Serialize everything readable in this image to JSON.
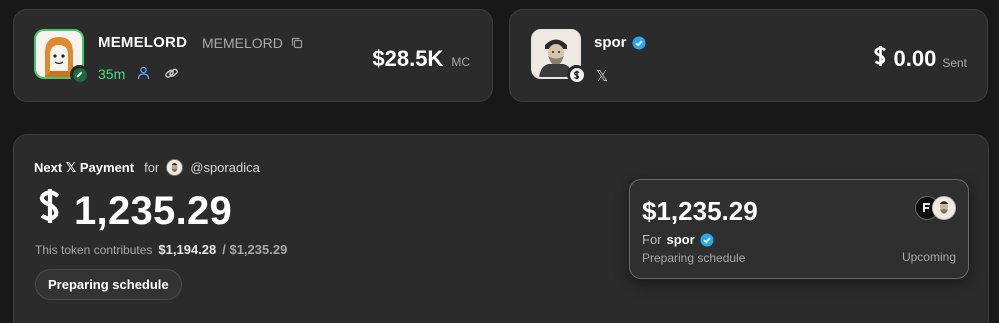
{
  "colors": {
    "accent_green": "#4ade80",
    "verified_blue": "#29a8f0",
    "card_bg": "#2b2b2b"
  },
  "token": {
    "name": "MEMELORD",
    "symbol": "MEMELORD",
    "age": "35m",
    "market_cap": "$28.5K",
    "market_cap_label": "MC",
    "icons": [
      "copy-icon",
      "holder-icon",
      "link-icon",
      "pencil-icon"
    ]
  },
  "creator": {
    "name": "spor",
    "verified": true,
    "sent_amount": "0.00",
    "sent_label": "Sent",
    "icons": [
      "verified-icon",
      "x-icon",
      "currency-icon"
    ]
  },
  "payment": {
    "title": "Next 𝕏 Payment",
    "for_label": "for",
    "handle": "@sporadica",
    "amount": "1,235.29",
    "contrib_text": "This token contributes",
    "contrib_amount": "$1,194.28",
    "contrib_total": "/ $1,235.29",
    "status": "Preparing schedule",
    "schedule": {
      "amount": "$1,235.29",
      "for_label": "For",
      "recipient": "spor",
      "status": "Preparing schedule",
      "state": "Upcoming"
    }
  }
}
